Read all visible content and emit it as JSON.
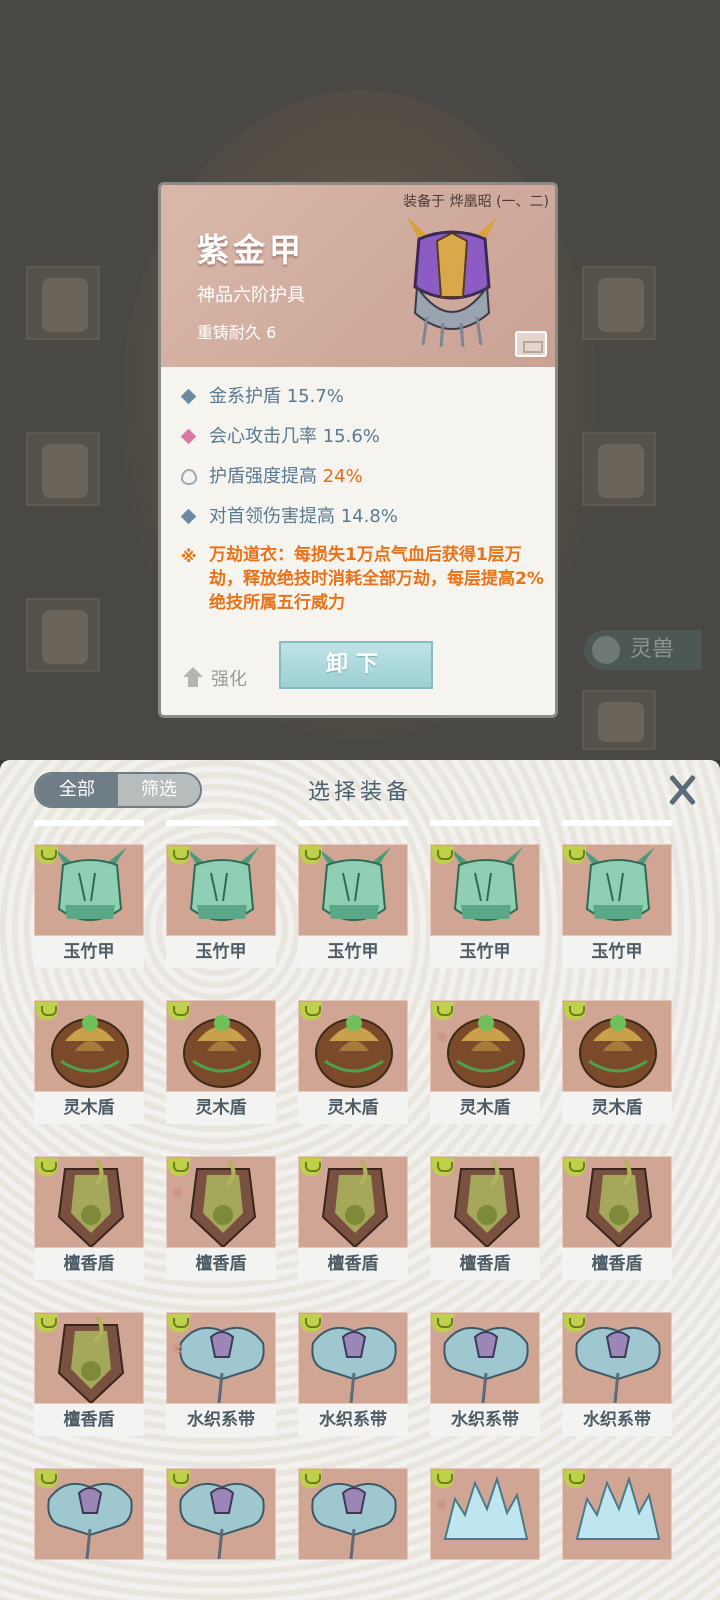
{
  "background": {
    "spirit_beast_label": "灵兽"
  },
  "detail": {
    "equipped_on": "装备于 烨凰昭 (一、二)",
    "name": "紫金甲",
    "grade": "神品六阶护具",
    "durability": "重铸耐久 6",
    "stats": [
      {
        "text": "金系护盾 15.7%",
        "highlight": "",
        "mark": "diamond"
      },
      {
        "text": "会心攻击几率 15.6%",
        "highlight": "",
        "mark": "diamond-pink"
      },
      {
        "text": "护盾强度提高 ",
        "highlight": "24%",
        "mark": "flame"
      },
      {
        "text": "对首领伤害提高 14.8%",
        "highlight": "",
        "mark": "diamond"
      }
    ],
    "special": "万劫道衣：每损失1万点气血后获得1层万劫，释放绝技时消耗全部万劫，每层提高2%绝技所属五行威力",
    "special_mark": "※",
    "upgrade_label": "强化",
    "unequip_label": "卸下"
  },
  "panel": {
    "tab_all": "全部",
    "tab_filter": "筛选",
    "title": "选择装备",
    "items": [
      {
        "name": "玉竹甲",
        "kind": "jade",
        "linked": false
      },
      {
        "name": "玉竹甲",
        "kind": "jade",
        "linked": false
      },
      {
        "name": "玉竹甲",
        "kind": "jade",
        "linked": false
      },
      {
        "name": "玉竹甲",
        "kind": "jade",
        "linked": false
      },
      {
        "name": "玉竹甲",
        "kind": "jade",
        "linked": false
      },
      {
        "name": "灵木盾",
        "kind": "wood",
        "linked": false
      },
      {
        "name": "灵木盾",
        "kind": "wood",
        "linked": false
      },
      {
        "name": "灵木盾",
        "kind": "wood",
        "linked": false
      },
      {
        "name": "灵木盾",
        "kind": "wood",
        "linked": true
      },
      {
        "name": "灵木盾",
        "kind": "wood",
        "linked": false
      },
      {
        "name": "檀香盾",
        "kind": "sandal",
        "linked": false
      },
      {
        "name": "檀香盾",
        "kind": "sandal",
        "linked": true
      },
      {
        "name": "檀香盾",
        "kind": "sandal",
        "linked": false
      },
      {
        "name": "檀香盾",
        "kind": "sandal",
        "linked": false
      },
      {
        "name": "檀香盾",
        "kind": "sandal",
        "linked": false
      },
      {
        "name": "檀香盾",
        "kind": "sandal",
        "linked": false
      },
      {
        "name": "水织系带",
        "kind": "water",
        "linked": true
      },
      {
        "name": "水织系带",
        "kind": "water",
        "linked": false
      },
      {
        "name": "水织系带",
        "kind": "water",
        "linked": false
      },
      {
        "name": "水织系带",
        "kind": "water",
        "linked": false
      },
      {
        "name": "",
        "kind": "water",
        "linked": false
      },
      {
        "name": "",
        "kind": "water",
        "linked": false
      },
      {
        "name": "",
        "kind": "water",
        "linked": false
      },
      {
        "name": "",
        "kind": "ice",
        "linked": true
      },
      {
        "name": "",
        "kind": "ice",
        "linked": false
      }
    ]
  },
  "colors": {
    "accent_orange": "#e8731a",
    "stat_blue": "#5a7a92",
    "item_bg": "#d1a594",
    "button_teal": "#9ccfd3"
  }
}
